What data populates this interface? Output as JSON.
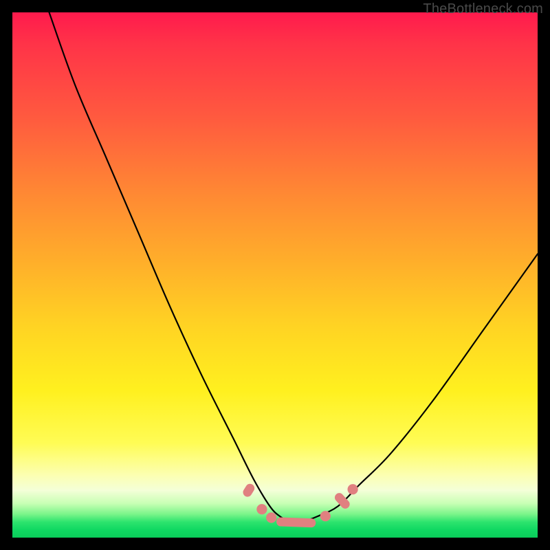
{
  "watermark": "TheBottleneck.com",
  "colors": {
    "frame": "#000000",
    "curve": "#000000",
    "marker": "#e08080",
    "gradient_stops": [
      "#ff1a4d",
      "#ff5a3f",
      "#ff8a33",
      "#ffb02a",
      "#ffd423",
      "#fff01f",
      "#fcffb0",
      "#7cf58a",
      "#10d862"
    ]
  },
  "chart_data": {
    "type": "line",
    "title": "",
    "xlabel": "",
    "ylabel": "",
    "xlim": [
      0,
      100
    ],
    "ylim": [
      0,
      100
    ],
    "grid": false,
    "legend": false,
    "note": "V-shaped bottleneck curve over rainbow gradient. y≈100 is top, y≈0 is bottom trough. No axes or tick labels are rendered in the image; x/y values are estimated from pixel positions.",
    "series": [
      {
        "name": "bottleneck-curve",
        "x": [
          7,
          12,
          18,
          24,
          30,
          36,
          42,
          46,
          49,
          51,
          53,
          55,
          58,
          62,
          66,
          72,
          80,
          90,
          100
        ],
        "y": [
          100,
          86,
          72,
          58,
          44,
          31,
          19,
          11,
          6,
          4,
          3,
          3,
          4,
          6,
          10,
          16,
          26,
          40,
          54
        ]
      }
    ],
    "markers": [
      {
        "shape": "pill",
        "x": 45.0,
        "y": 9.0,
        "angle_deg": -58,
        "len": 2.6
      },
      {
        "shape": "circle",
        "x": 47.5,
        "y": 5.4,
        "r": 1.0
      },
      {
        "shape": "circle",
        "x": 49.3,
        "y": 3.8,
        "r": 1.0
      },
      {
        "shape": "pill",
        "x": 54.0,
        "y": 2.9,
        "angle_deg": 2,
        "len": 7.5
      },
      {
        "shape": "circle",
        "x": 59.6,
        "y": 4.1,
        "r": 1.0
      },
      {
        "shape": "pill",
        "x": 62.8,
        "y": 7.0,
        "angle_deg": 48,
        "len": 3.4
      },
      {
        "shape": "circle",
        "x": 64.8,
        "y": 9.2,
        "r": 1.0
      }
    ]
  }
}
